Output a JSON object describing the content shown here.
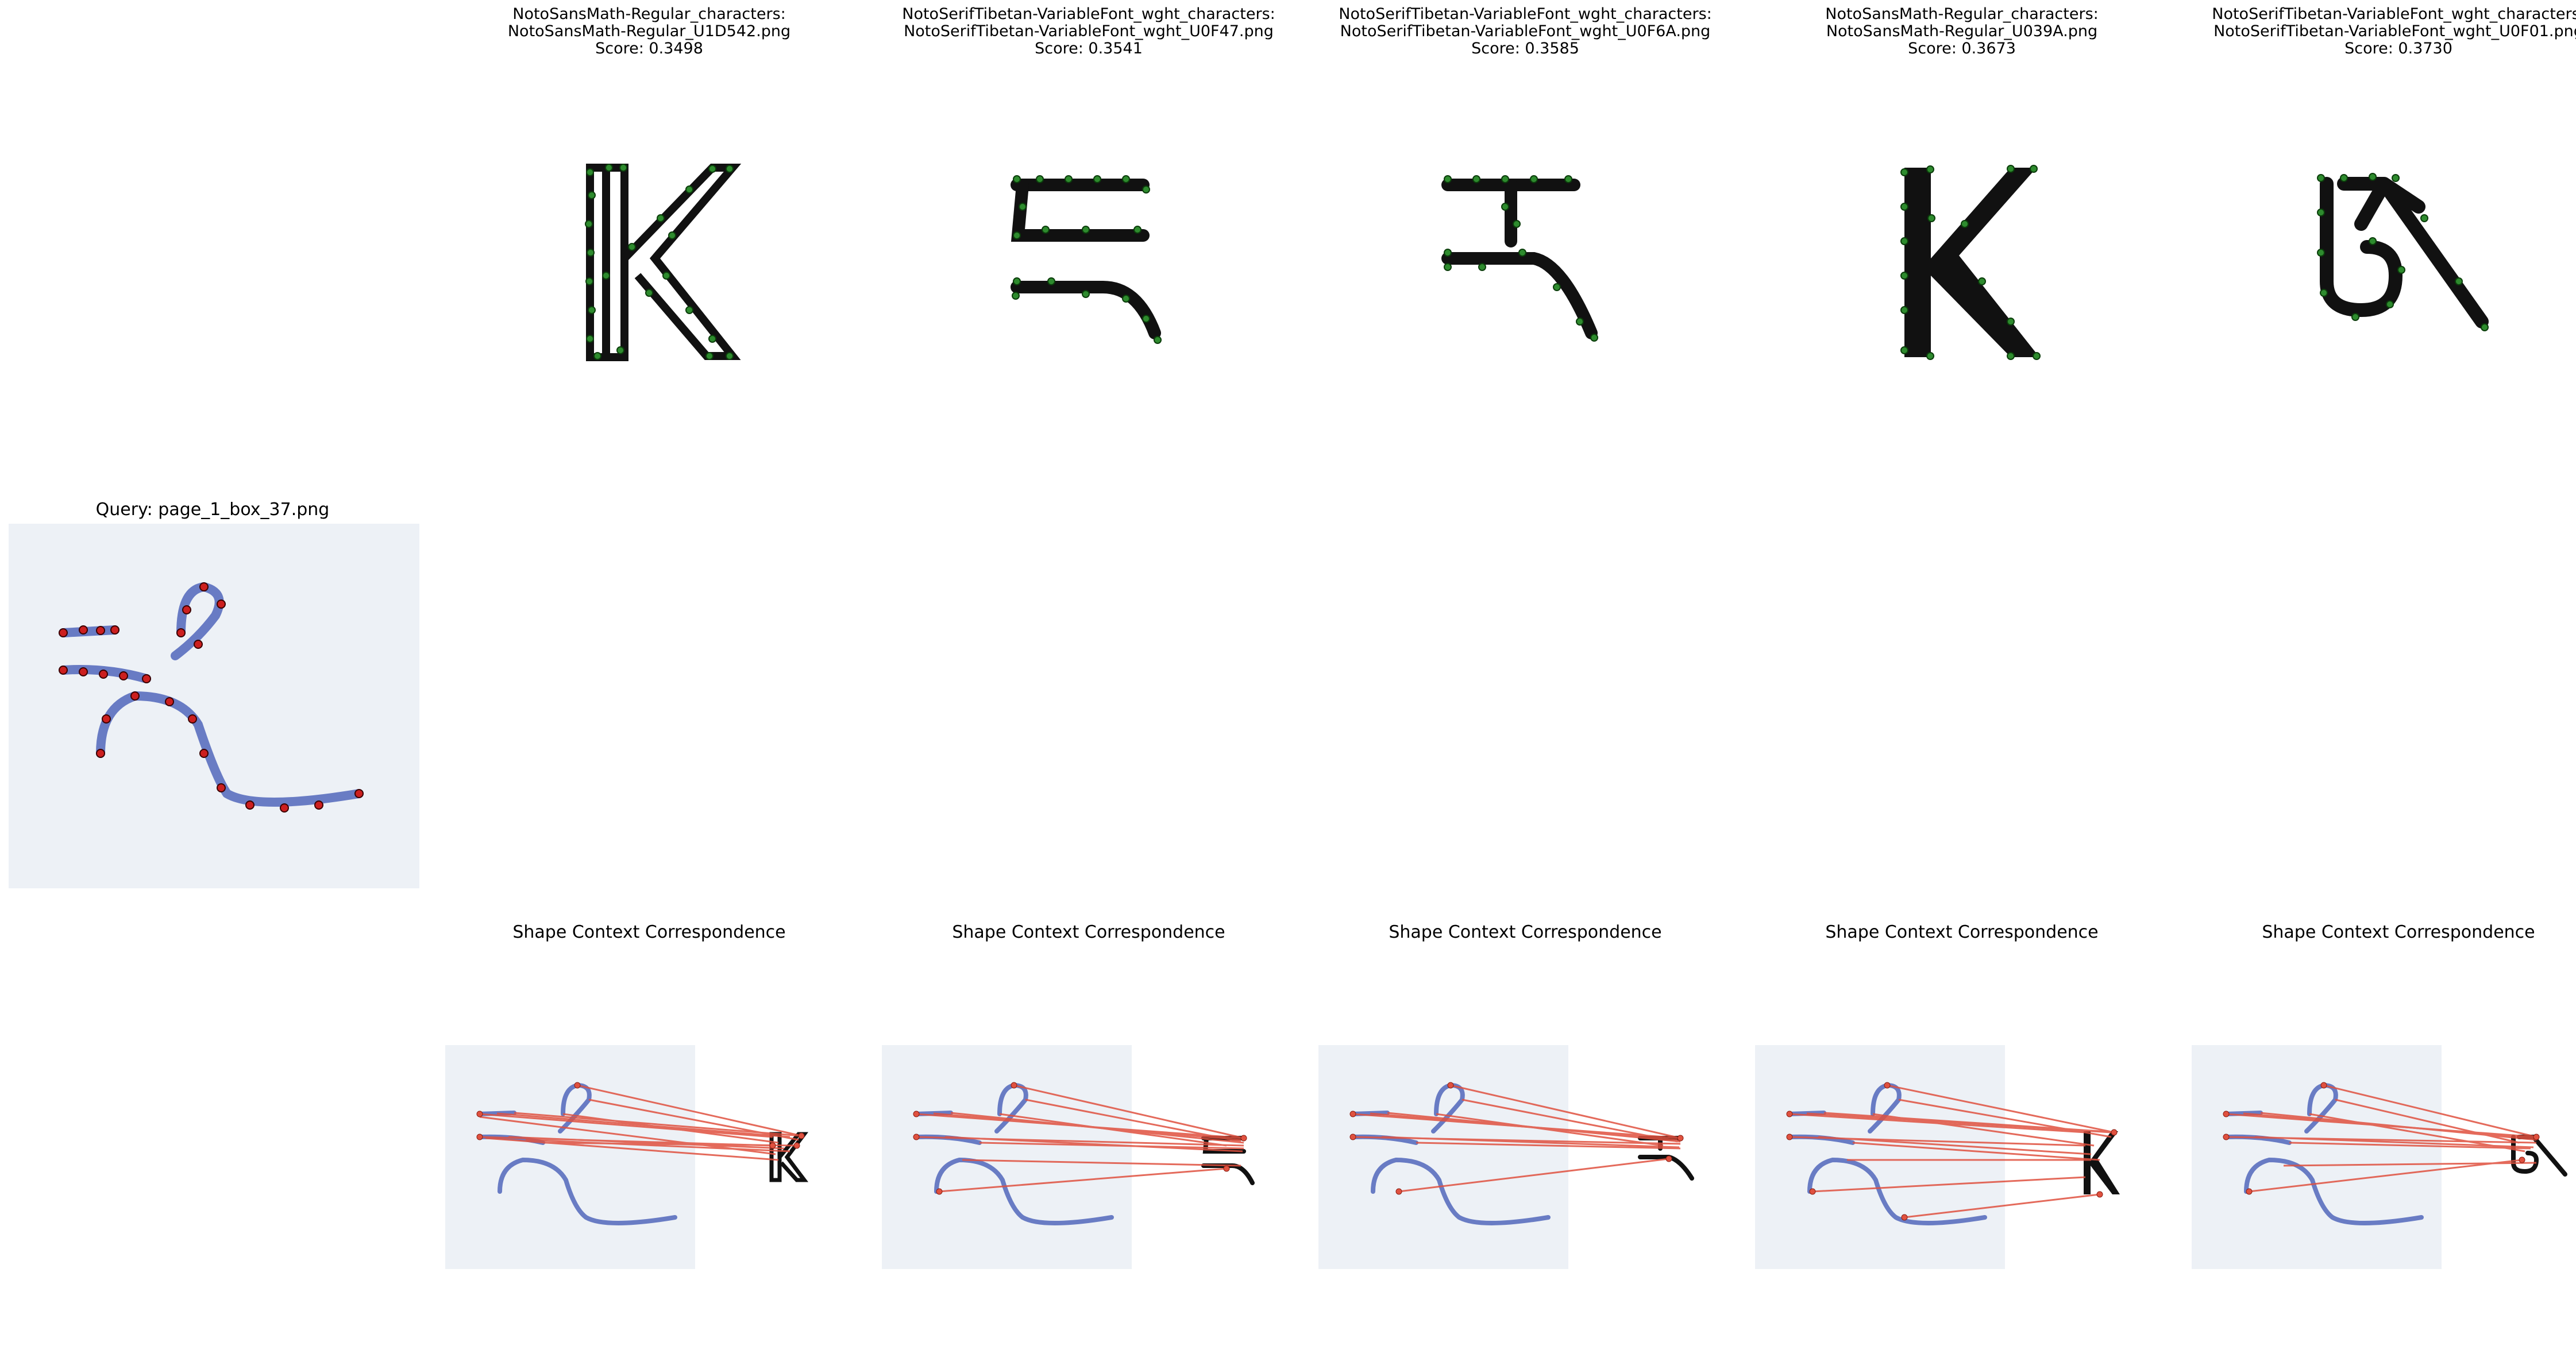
{
  "query": {
    "title": "Query: page_1_box_37.png"
  },
  "candidates": [
    {
      "line1": "NotoSansMath-Regular_characters:",
      "line2": "NotoSansMath-Regular_U1D542.png",
      "score": "Score: 0.3498",
      "glyph": "K-outline"
    },
    {
      "line1": "NotoSerifTibetan-VariableFont_wght_characters:",
      "line2": "NotoSerifTibetan-VariableFont_wght_U0F47.png",
      "score": "Score: 0.3541",
      "glyph": "tibetan-ja"
    },
    {
      "line1": "NotoSerifTibetan-VariableFont_wght_characters:",
      "line2": "NotoSerifTibetan-VariableFont_wght_U0F6A.png",
      "score": "Score: 0.3585",
      "glyph": "tibetan-ra"
    },
    {
      "line1": "NotoSansMath-Regular_characters:",
      "line2": "NotoSansMath-Regular_U039A.png",
      "score": "Score: 0.3673",
      "glyph": "K-solid"
    },
    {
      "line1": "NotoSerifTibetan-VariableFont_wght_characters:",
      "line2": "NotoSerifTibetan-VariableFont_wght_U0F01.png",
      "score": "Score: 0.3730",
      "glyph": "tibetan-om"
    }
  ],
  "correspondence": {
    "title": "Shape Context Correspondence"
  },
  "colors": {
    "query_points": "#cc1f1f",
    "candidate_points": "#2e8b2e",
    "ink": "#5a6fbf",
    "lines": "#e0513f"
  }
}
